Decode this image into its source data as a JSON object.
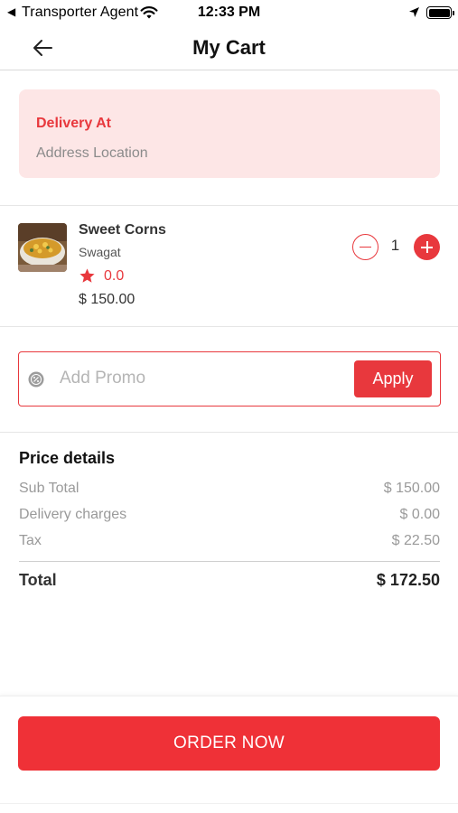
{
  "status_bar": {
    "back_indicator": "◀",
    "carrier": "Transporter Agent",
    "time": "12:33 PM"
  },
  "header": {
    "title": "My Cart"
  },
  "delivery": {
    "title": "Delivery At",
    "address": "Address Location"
  },
  "cart_item": {
    "name": "Sweet Corns",
    "restaurant": "Swagat",
    "rating": "0.0",
    "price": "$ 150.00",
    "quantity": "1"
  },
  "promo": {
    "placeholder": "Add Promo",
    "value": "",
    "apply_label": "Apply"
  },
  "price_details": {
    "title": "Price details",
    "rows": [
      {
        "label": "Sub Total",
        "value": "$ 150.00"
      },
      {
        "label": "Delivery charges",
        "value": "$ 0.00"
      },
      {
        "label": "Tax",
        "value": "$ 22.50"
      }
    ],
    "total_label": "Total",
    "total_value": "$ 172.50"
  },
  "order_button": {
    "label": "ORDER NOW"
  },
  "colors": {
    "accent": "#e8383d",
    "delivery_bg": "#fde6e6",
    "muted_text": "#9a9a9a"
  },
  "icons": {
    "back": "arrow-left-icon",
    "wifi": "wifi-icon",
    "location": "location-arrow-icon",
    "battery": "battery-icon",
    "star": "star-icon",
    "promo": "promo-percent-icon",
    "minus": "minus-icon",
    "plus": "plus-icon"
  }
}
